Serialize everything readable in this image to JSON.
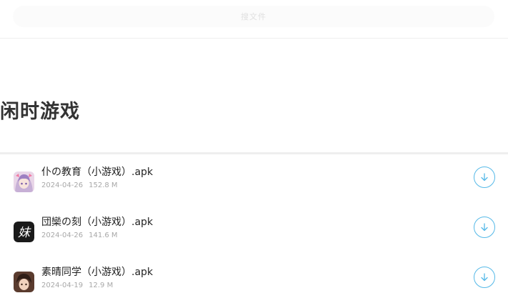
{
  "search": {
    "placeholder": "搜文件"
  },
  "section": {
    "title": "闲时游戏"
  },
  "files": [
    {
      "name": "仆の教育（小游戏）.apk",
      "date": "2024-04-26",
      "size": "152.8 M",
      "icon": "anime-girl-icon"
    },
    {
      "name": "団欒の刻（小游戏）.apk",
      "date": "2024-04-26",
      "size": "141.6 M",
      "icon": "mei-kanji-icon"
    },
    {
      "name": "素晴同学（小游戏）.apk",
      "date": "2024-04-19",
      "size": "12.9 M",
      "icon": "anime-boy-icon"
    }
  ],
  "icons": {
    "download": "download-arrow-icon"
  },
  "colors": {
    "accent": "#55b9e8",
    "meta_text": "#a8a8a8",
    "title_text": "#333333"
  }
}
